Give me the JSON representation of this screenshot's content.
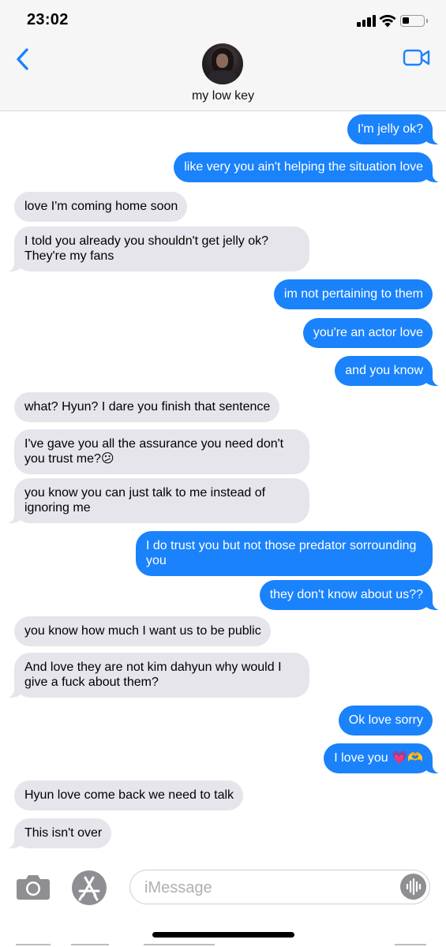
{
  "status_bar": {
    "time": "23:02",
    "battery_level": 0.25,
    "icons": [
      "signal-bars-icon",
      "wifi-icon",
      "battery-icon"
    ]
  },
  "header": {
    "contact_name": "my low key",
    "back_icon": "chevron-left-icon",
    "video_icon": "video-camera-icon",
    "accent_color": "#1a82fb"
  },
  "messages": [
    {
      "from": "me",
      "text": "I'm jelly ok?"
    },
    {
      "from": "me",
      "text": "like very you ain't helping the situation love"
    },
    {
      "from": "them",
      "text": "love I'm coming home soon"
    },
    {
      "from": "them",
      "text": "I told you already you shouldn't get jelly ok? They're my fans"
    },
    {
      "from": "me",
      "text": "im not pertaining to them"
    },
    {
      "from": "me",
      "text": "you're an actor love"
    },
    {
      "from": "me",
      "text": "and you know"
    },
    {
      "from": "them",
      "text": "what? Hyun? I dare you finish that sentence"
    },
    {
      "from": "them",
      "text": "I've gave you all the assurance you need don't you trust me?😕"
    },
    {
      "from": "them",
      "text": "you know you can just talk to me instead of ignoring me"
    },
    {
      "from": "me",
      "text": "I do trust you but not those predator sorrounding you"
    },
    {
      "from": "me",
      "text": "they don't know about us??"
    },
    {
      "from": "them",
      "text": "you know how much I want us to be public"
    },
    {
      "from": "them",
      "text": "And love they are not kim dahyun why would I give a fuck about them?"
    },
    {
      "from": "me",
      "text": "Ok love sorry"
    },
    {
      "from": "me",
      "text": "I love you 💗🫶"
    },
    {
      "from": "them",
      "text": "Hyun love come back we need to talk"
    },
    {
      "from": "them",
      "text": "This isn't over"
    }
  ],
  "input_bar": {
    "placeholder": "iMessage",
    "camera_icon": "camera-icon",
    "apps_icon": "app-store-icon",
    "audio_icon": "audio-waveform-icon"
  },
  "colors": {
    "sent_bubble": "#1a82fb",
    "received_bubble": "#e6e5eb",
    "header_background": "#f6f6f6"
  }
}
